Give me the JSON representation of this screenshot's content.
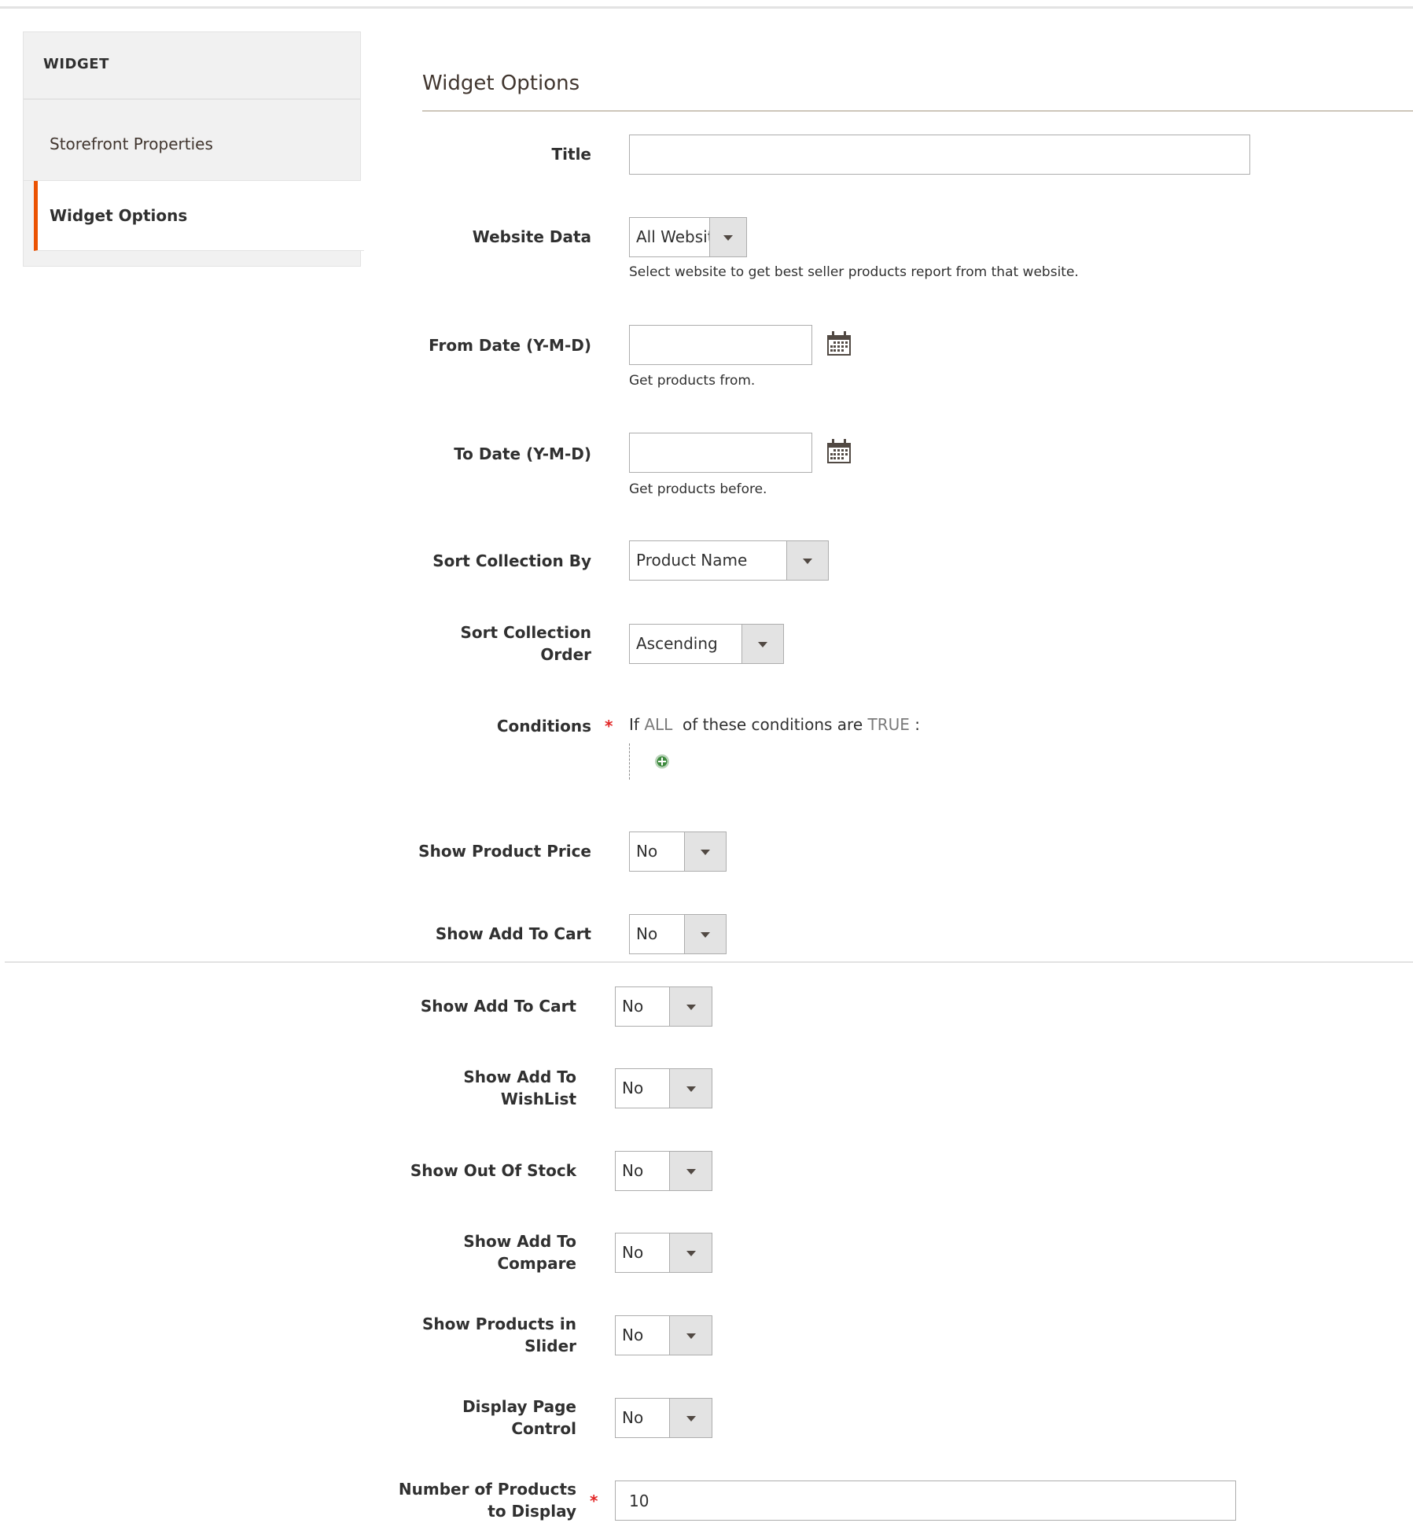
{
  "sidebar": {
    "header": "WIDGET",
    "items": [
      {
        "label": "Storefront Properties",
        "active": false
      },
      {
        "label": "Widget Options",
        "active": true
      }
    ]
  },
  "section": {
    "title": "Widget Options"
  },
  "colors": {
    "accent": "#eb5202",
    "required": "#e22626",
    "border": "#adadad",
    "select_button": "#e3e3e3"
  },
  "fields": {
    "title": {
      "label": "Title",
      "value": ""
    },
    "website_data": {
      "label": "Website Data",
      "value": "All Website",
      "note": "Select website to get best seller products report from that website."
    },
    "from_date": {
      "label": "From Date (Y-M-D)",
      "value": "",
      "note": "Get products from.",
      "icon": "calendar-icon"
    },
    "to_date": {
      "label": "To Date (Y-M-D)",
      "value": "",
      "note": "Get products before.",
      "icon": "calendar-icon"
    },
    "sort_by": {
      "label": "Sort Collection By",
      "value": "Product Name"
    },
    "sort_order": {
      "label_line1": "Sort Collection",
      "label_line2": "Order",
      "value": "Ascending"
    },
    "conditions": {
      "label": "Conditions",
      "required_mark": "*",
      "prefix": "If",
      "aggregator": "ALL",
      "middle": "of these conditions are",
      "value": "TRUE",
      "suffix": ":",
      "add_icon": "plus-circle-icon"
    },
    "show_product_price": {
      "label": "Show Product Price",
      "value": "No"
    },
    "show_add_to_cart": {
      "label": "Show Add To Cart",
      "value": "No"
    }
  },
  "fields2": {
    "show_add_to_cart": {
      "label": "Show Add To Cart",
      "value": "No"
    },
    "show_add_to_wishlist": {
      "label_line1": "Show Add To",
      "label_line2": "WishList",
      "value": "No"
    },
    "show_out_of_stock": {
      "label": "Show Out Of Stock",
      "value": "No"
    },
    "show_add_to_compare": {
      "label_line1": "Show Add To",
      "label_line2": "Compare",
      "value": "No"
    },
    "show_in_slider": {
      "label_line1": "Show Products in",
      "label_line2": "Slider",
      "value": "No"
    },
    "display_page_control": {
      "label_line1": "Display Page",
      "label_line2": "Control",
      "value": "No"
    },
    "number_of_products": {
      "label_line1": "Number of Products",
      "label_line2": "to Display",
      "required_mark": "*",
      "value": "10"
    }
  }
}
